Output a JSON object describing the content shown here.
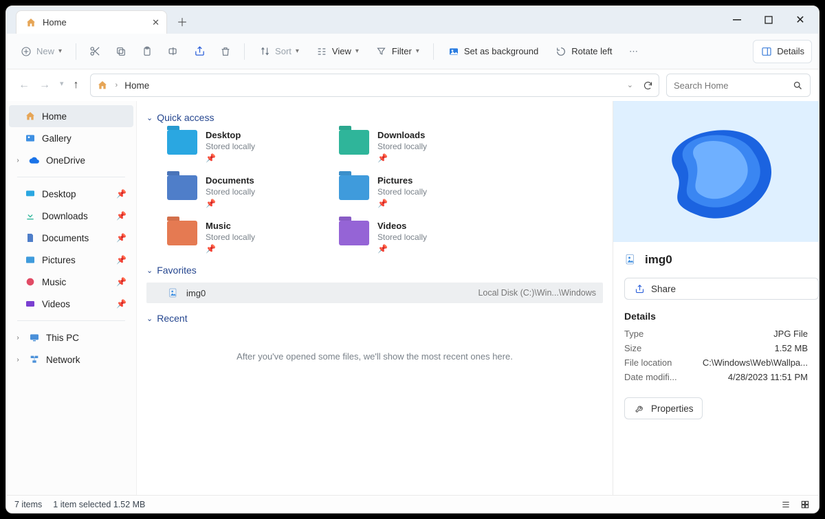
{
  "tab": {
    "title": "Home"
  },
  "toolbar": {
    "new": "New",
    "sort": "Sort",
    "view": "View",
    "filter": "Filter",
    "set_background": "Set as background",
    "rotate_left": "Rotate left",
    "details": "Details"
  },
  "address": {
    "crumb": "Home"
  },
  "search": {
    "placeholder": "Search Home"
  },
  "sidebar": {
    "home": "Home",
    "gallery": "Gallery",
    "onedrive": "OneDrive",
    "desktop": "Desktop",
    "downloads": "Downloads",
    "documents": "Documents",
    "pictures": "Pictures",
    "music": "Music",
    "videos": "Videos",
    "this_pc": "This PC",
    "network": "Network"
  },
  "groups": {
    "quick_access": "Quick access",
    "favorites": "Favorites",
    "recent": "Recent"
  },
  "quick_access": [
    {
      "name": "Desktop",
      "sub": "Stored locally",
      "color": "#2aa7e1"
    },
    {
      "name": "Downloads",
      "sub": "Stored locally",
      "color": "#2fb59a"
    },
    {
      "name": "Documents",
      "sub": "Stored locally",
      "color": "#4f7ec9"
    },
    {
      "name": "Pictures",
      "sub": "Stored locally",
      "color": "#3f9bdc"
    },
    {
      "name": "Music",
      "sub": "Stored locally",
      "color": "#e57a52"
    },
    {
      "name": "Videos",
      "sub": "Stored locally",
      "color": "#9564d6"
    }
  ],
  "favorite": {
    "name": "img0",
    "path": "Local Disk (C:)\\Win...\\Windows"
  },
  "recent_empty": "After you've opened some files, we'll show the most recent ones here.",
  "details": {
    "filename": "img0",
    "share": "Share",
    "section": "Details",
    "properties": "Properties",
    "rows": [
      {
        "k": "Type",
        "v": "JPG File"
      },
      {
        "k": "Size",
        "v": "1.52 MB"
      },
      {
        "k": "File location",
        "v": "C:\\Windows\\Web\\Wallpa..."
      },
      {
        "k": "Date modifi...",
        "v": "4/28/2023 11:51 PM"
      }
    ]
  },
  "status": {
    "count": "7 items",
    "selection": "1 item selected  1.52 MB"
  }
}
